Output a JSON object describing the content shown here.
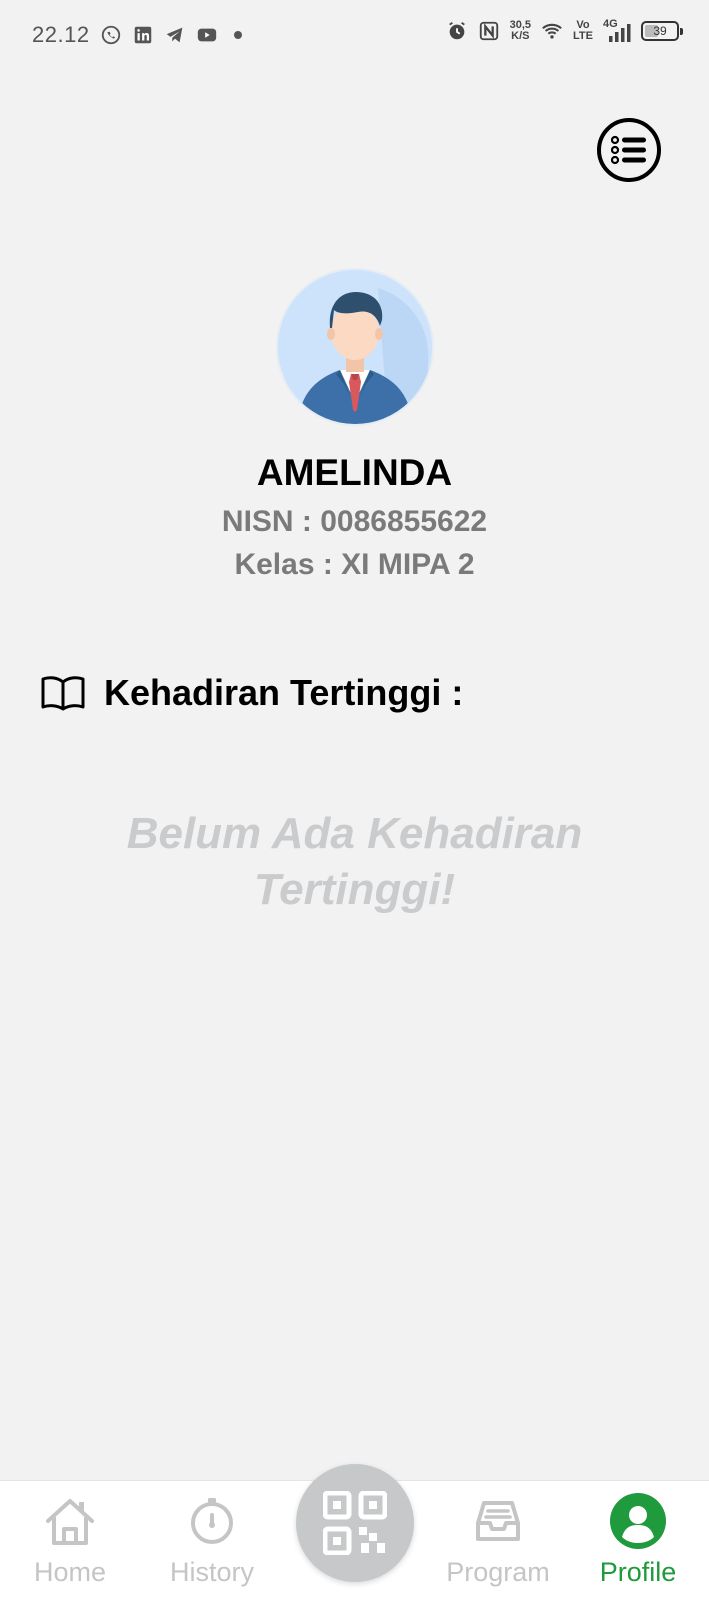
{
  "status_bar": {
    "time": "22.12",
    "network_speed_value": "30,5",
    "network_speed_unit": "K/S",
    "volte_top": "Vo",
    "volte_bottom": "LTE",
    "signal_label": "4G",
    "battery_percent": "39"
  },
  "profile": {
    "name": "AMELINDA",
    "nisn": "NISN : 0086855622",
    "kelas": "Kelas : XI MIPA 2"
  },
  "attendance": {
    "section_title": "Kehadiran Tertinggi :",
    "empty_line1": "Belum Ada Kehadiran",
    "empty_line2": "Tertinggi!"
  },
  "bottom_nav": {
    "items": [
      {
        "label": "Home",
        "icon": "home-icon"
      },
      {
        "label": "History",
        "icon": "stopwatch-icon"
      },
      {
        "label": "Program",
        "icon": "inbox-icon"
      },
      {
        "label": "Profile",
        "icon": "user-icon"
      }
    ],
    "active_item": "Profile",
    "center_button_icon": "qr-code-icon"
  },
  "colors": {
    "background": "#f2f2f3",
    "active_nav": "#1f9a3c",
    "inactive_nav": "#c5c5c5",
    "muted_text": "#7a7a7a",
    "empty_text": "#c9cbcd"
  }
}
